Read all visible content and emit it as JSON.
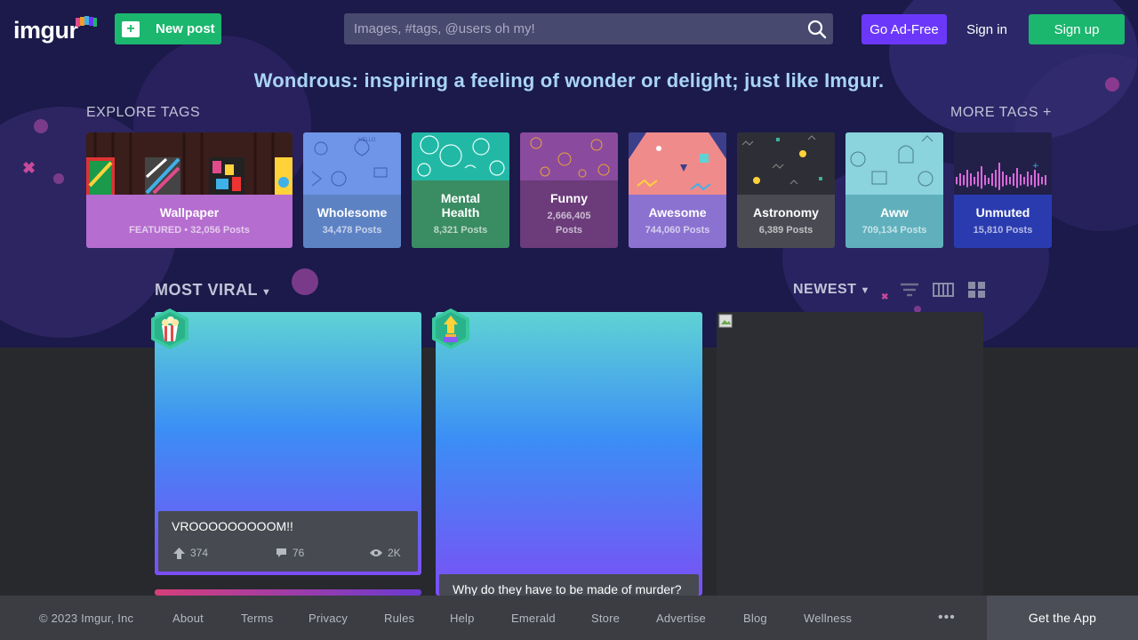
{
  "header": {
    "logo_text": "imgur",
    "new_post_label": "New post",
    "search_placeholder": "Images, #tags, @users oh my!",
    "ad_free_label": "Go Ad-Free",
    "sign_in_label": "Sign in",
    "sign_up_label": "Sign up"
  },
  "tagline": "Wondrous: inspiring a feeling of wonder or delight; just like Imgur.",
  "explore": {
    "title": "EXPLORE TAGS",
    "more_label": "MORE TAGS +",
    "tags": [
      {
        "name": "Wallpaper",
        "count": "FEATURED • 32,056 Posts",
        "color": "#b56dcf"
      },
      {
        "name": "Wholesome",
        "count": "34,478 Posts",
        "color": "#5d82c4"
      },
      {
        "name": "Mental Health",
        "count": "8,321 Posts",
        "color": "#3a8c62"
      },
      {
        "name": "Funny",
        "count": "2,666,405 Posts",
        "color": "#6b3b7a"
      },
      {
        "name": "Awesome",
        "count": "744,060 Posts",
        "color": "#8b72d1"
      },
      {
        "name": "Astronomy",
        "count": "6,389 Posts",
        "color": "#4a4b52"
      },
      {
        "name": "Aww",
        "count": "709,134 Posts",
        "color": "#5fb0bc"
      },
      {
        "name": "Unmuted",
        "count": "15,810 Posts",
        "color": "#2a3bb0"
      }
    ]
  },
  "feed": {
    "sort_label": "MOST VIRAL",
    "order_label": "NEWEST",
    "posts": [
      {
        "title": "VROOOOOOOOOM!!",
        "upvotes": "374",
        "comments": "76",
        "views": "2K"
      },
      {
        "title": "Why do they have to be made of murder?"
      }
    ]
  },
  "footer": {
    "copyright": "© 2023 Imgur, Inc",
    "links": [
      "About",
      "Terms",
      "Privacy",
      "Rules",
      "Help",
      "Emerald",
      "Store",
      "Advertise",
      "Blog",
      "Wellness"
    ],
    "more": "•••",
    "get_app": "Get the App"
  }
}
